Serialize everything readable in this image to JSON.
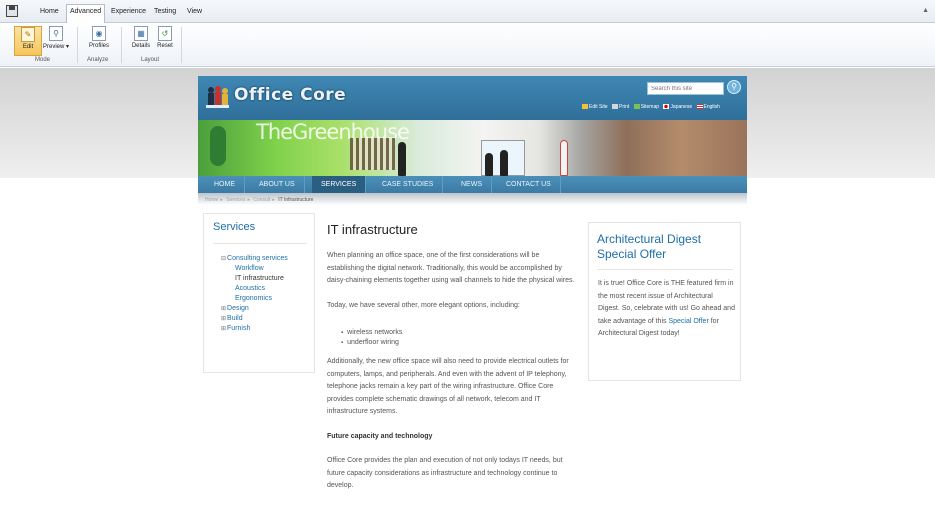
{
  "ribbon": {
    "tabs": [
      "Home",
      "Advanced",
      "Experience",
      "Testing",
      "View"
    ],
    "active_tab": "Advanced",
    "buttons": {
      "edit": "Edit",
      "preview": "Preview ▾",
      "profiles": "Profiles",
      "details": "Details",
      "reset": "Reset"
    },
    "groups": {
      "mode": "Mode",
      "analyze": "Analyze",
      "layout": "Layout"
    }
  },
  "site": {
    "logo_text": "Office Core",
    "search_placeholder": "Search this site",
    "utility_links": [
      "Edit Site",
      "Print",
      "Sitemap",
      "Japanese",
      "English"
    ],
    "banner_title": "TheGreenhouse"
  },
  "nav": {
    "items": [
      "HOME",
      "ABOUT US",
      "SERVICES",
      "CASE STUDIES",
      "NEWS",
      "CONTACT US"
    ],
    "active": "SERVICES"
  },
  "breadcrumb": [
    "Home",
    "Services",
    "Consult",
    "IT Infrastructure"
  ],
  "sidebar": {
    "title": "Services",
    "tree": {
      "consulting": "Consulting services",
      "workflow": "Workflow",
      "it_infrastructure": "IT infrastructure",
      "acoustics": "Acoustics",
      "ergonomics": "Ergonomics",
      "design": "Design",
      "build": "Build",
      "furnish": "Furnish"
    }
  },
  "article": {
    "title": "IT infrastructure",
    "p1": "When planning an office space, one of the first considerations will be establishing the digital network. Traditionally, this would be accomplished by daisy-chaining elements together using wall channels to hide the physical wires.",
    "p2": "Today, we have several other, more elegant options, including:",
    "bullets": [
      "wireless networks",
      "underfloor wiring"
    ],
    "p3": "Additionally, the new office space will also need to provide electrical outlets for computers, lamps, and peripherals. And even with the advent of IP telephony, telephone jacks remain a key part of the wiring infrastructure. Office Core provides complete schematic drawings of all network, telecom and IT infrastructure systems.",
    "subheading": "Future capacity and technology",
    "p4": "Office Core provides the plan and execution of not only todays IT needs, but future capacity considerations as infrastructure and technology continue to develop."
  },
  "promo": {
    "title": "Architectural Digest Special Offer",
    "body_start": "It is true! Office Core is THE featured firm in the most recent issue of Architectural Digest. So, celebrate with us! Go ahead and take advantage of this ",
    "link": "Special Offer",
    "body_end": " for Architectural Digest today!"
  },
  "colors": {
    "brand_blue": "#2f6f9a",
    "link_blue": "#1e6ea8",
    "nav_active": "#2a5f82",
    "ribbon_active": "#f6c65c"
  }
}
